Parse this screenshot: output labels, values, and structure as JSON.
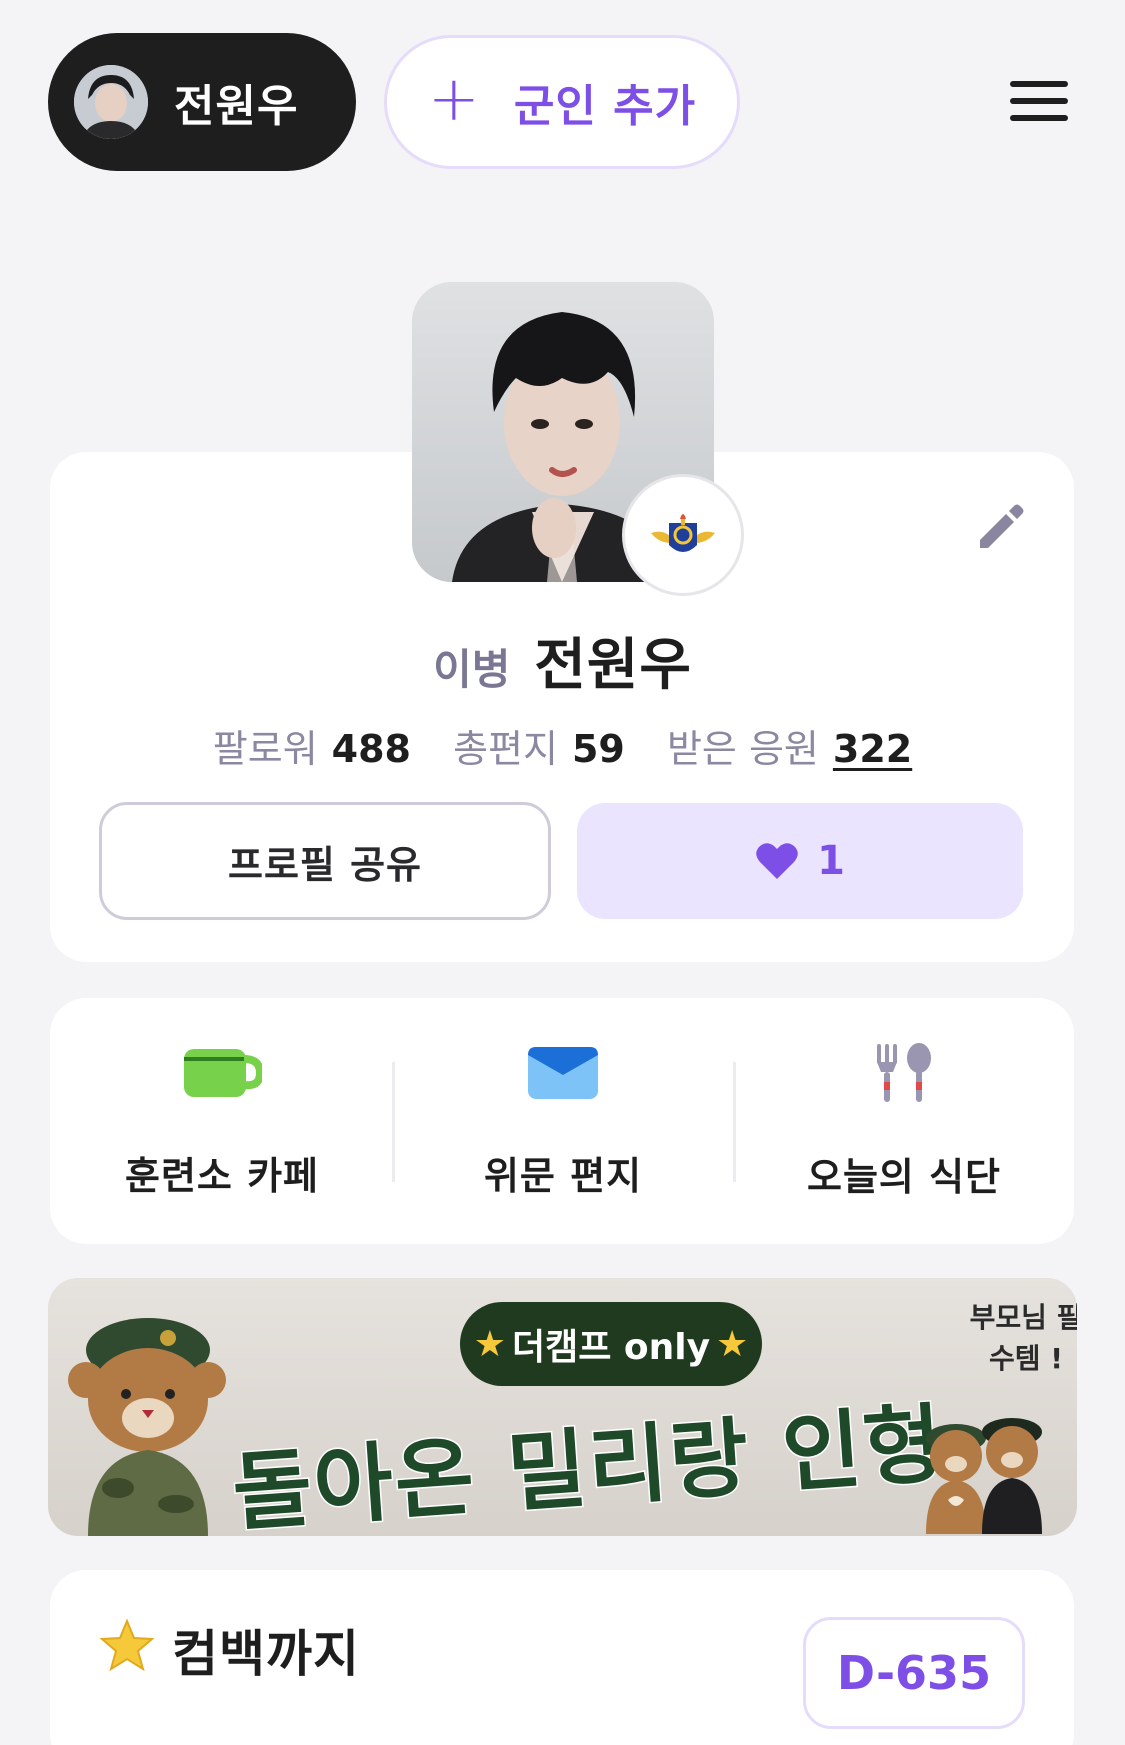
{
  "top_bar": {
    "user_name": "전원우",
    "add_soldier_label": "군인 추가",
    "add_icon": "+"
  },
  "profile": {
    "rank": "이병",
    "name": "전원우",
    "stats": {
      "followers_label": "팔로워",
      "followers_value": "488",
      "letters_label": "총편지",
      "letters_value": "59",
      "cheers_label": "받은 응원",
      "cheers_value": "322"
    },
    "share_label": "프로필 공유",
    "like_count": "1"
  },
  "quick_menu": [
    {
      "label": "훈련소 카페",
      "icon": "cup-icon"
    },
    {
      "label": "위문 편지",
      "icon": "mail-icon"
    },
    {
      "label": "오늘의 식단",
      "icon": "meal-icon"
    }
  ],
  "banner": {
    "tag": "더캠프 only",
    "title": "돌아온 밀리랑 인형",
    "side_note": "부모님 필수템 !"
  },
  "countdown": {
    "title": "컴백까지",
    "badge": "D-635"
  },
  "colors": {
    "accent": "#7d4fe6",
    "accent_light": "#ebe4ff",
    "dark": "#1e1e1f",
    "background": "#f4f4f6",
    "cup_green": "#78d14b",
    "mail_blue": "#4aa3f0"
  }
}
